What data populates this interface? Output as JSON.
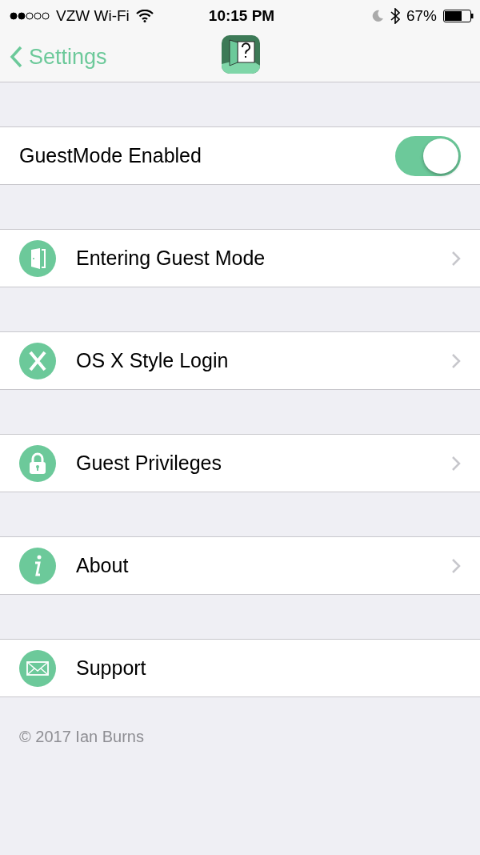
{
  "status_bar": {
    "carrier": "VZW Wi-Fi",
    "time": "10:15 PM",
    "battery": "67%"
  },
  "nav": {
    "back": "Settings"
  },
  "rows": [
    {
      "kind": "toggle",
      "label": "GuestMode Enabled",
      "on": true
    },
    {
      "kind": "disclosure",
      "label": "Entering Guest Mode"
    },
    {
      "kind": "disclosure",
      "label": "OS X Style Login"
    },
    {
      "kind": "disclosure",
      "label": "Guest Privileges"
    },
    {
      "kind": "disclosure",
      "label": "About"
    },
    {
      "kind": "plain",
      "label": "Support"
    }
  ],
  "footer": "© 2017 Ian Burns"
}
